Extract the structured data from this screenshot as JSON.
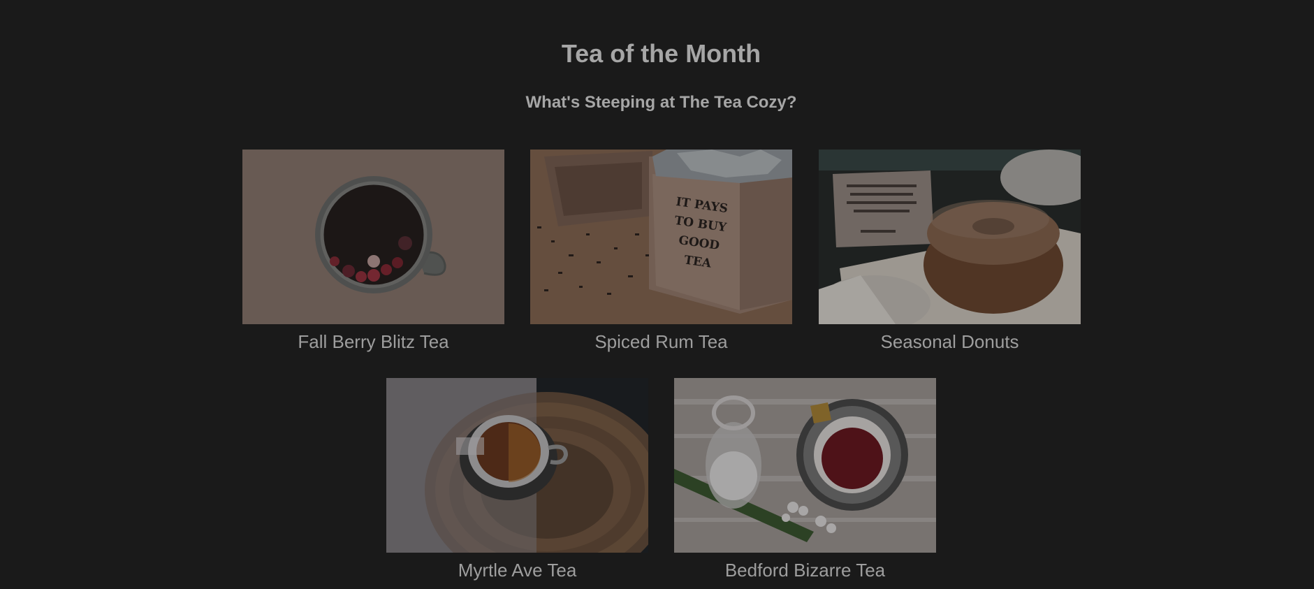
{
  "header": {
    "title": "Tea of the Month",
    "subtitle": "What's Steeping at The Tea Cozy?"
  },
  "gallery": {
    "items": [
      {
        "caption": "Fall Berry Blitz Tea",
        "icon": "berry-tea-photo"
      },
      {
        "caption": "Spiced Rum Tea",
        "icon": "tea-box-photo",
        "box_text": [
          "IT PAYS",
          "TO BUY",
          "GOOD",
          "TEA"
        ]
      },
      {
        "caption": "Seasonal Donuts",
        "icon": "donut-photo"
      },
      {
        "caption": "Myrtle Ave Tea",
        "icon": "teacup-on-tray-photo"
      },
      {
        "caption": "Bedford Bizarre Tea",
        "icon": "tea-with-sugar-jar-photo"
      }
    ]
  }
}
